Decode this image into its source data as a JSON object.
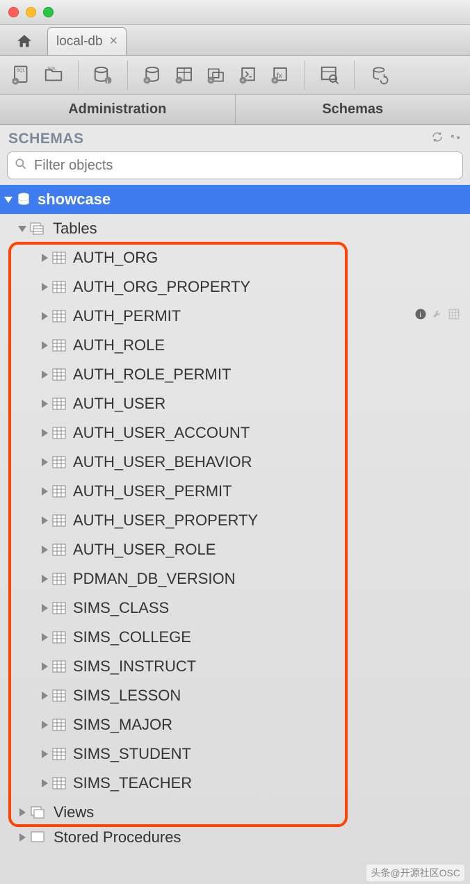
{
  "window": {
    "tab_label": "local-db"
  },
  "main_tabs": {
    "administration": "Administration",
    "schemas": "Schemas"
  },
  "schema_panel": {
    "title": "SCHEMAS",
    "filter_placeholder": "Filter objects"
  },
  "tree": {
    "schema_name": "showcase",
    "folders": {
      "tables": "Tables",
      "views": "Views",
      "stored_procedures": "Stored Procedures"
    },
    "tables": [
      "AUTH_ORG",
      "AUTH_ORG_PROPERTY",
      "AUTH_PERMIT",
      "AUTH_ROLE",
      "AUTH_ROLE_PERMIT",
      "AUTH_USER",
      "AUTH_USER_ACCOUNT",
      "AUTH_USER_BEHAVIOR",
      "AUTH_USER_PERMIT",
      "AUTH_USER_PROPERTY",
      "AUTH_USER_ROLE",
      "PDMAN_DB_VERSION",
      "SIMS_CLASS",
      "SIMS_COLLEGE",
      "SIMS_INSTRUCT",
      "SIMS_LESSON",
      "SIMS_MAJOR",
      "SIMS_STUDENT",
      "SIMS_TEACHER"
    ]
  },
  "watermark": "头条@开源社区OSC"
}
